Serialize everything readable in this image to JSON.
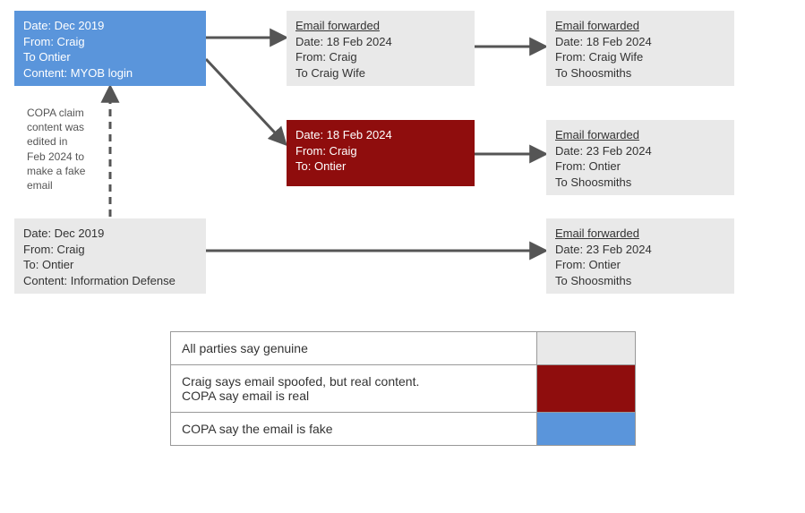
{
  "boxes": {
    "originBlue": {
      "l1": "Date: Dec 2019",
      "l2": "From: Craig",
      "l3": "To Ontier",
      "l4": "Content: MYOB login"
    },
    "fwd1": {
      "head": "Email forwarded",
      "l1": "Date: 18 Feb 2024",
      "l2": "From: Craig",
      "l3": "To Craig Wife"
    },
    "fwd2": {
      "head": "Email forwarded",
      "l1": "Date: 18 Feb 2024",
      "l2": "From: Craig Wife",
      "l3": "To Shoosmiths"
    },
    "redBox": {
      "l1": "Date: 18 Feb 2024",
      "l2": "From: Craig",
      "l3": "To: Ontier"
    },
    "fwd3": {
      "head": "Email forwarded",
      "l1": "Date: 23 Feb 2024",
      "l2": "From: Ontier",
      "l3": "To Shoosmiths"
    },
    "originGrey": {
      "l1": "Date: Dec 2019",
      "l2": "From: Craig",
      "l3": "To: Ontier",
      "l4": "Content: Information Defense"
    },
    "fwd4": {
      "head": "Email forwarded",
      "l1": "Date: 23 Feb 2024",
      "l2": "From: Ontier",
      "l3": "To Shoosmiths"
    }
  },
  "annotation": "COPA claim\ncontent was\nedited in\nFeb 2024 to\nmake a fake\nemail",
  "legend": {
    "row1": "All parties say genuine",
    "row2": "Craig says email spoofed, but real content.\nCOPA say email is real",
    "row3": "COPA say the email is fake"
  },
  "colors": {
    "grey": "#e9e9e9",
    "red": "#8f0d0d",
    "blue": "#5a95db"
  }
}
